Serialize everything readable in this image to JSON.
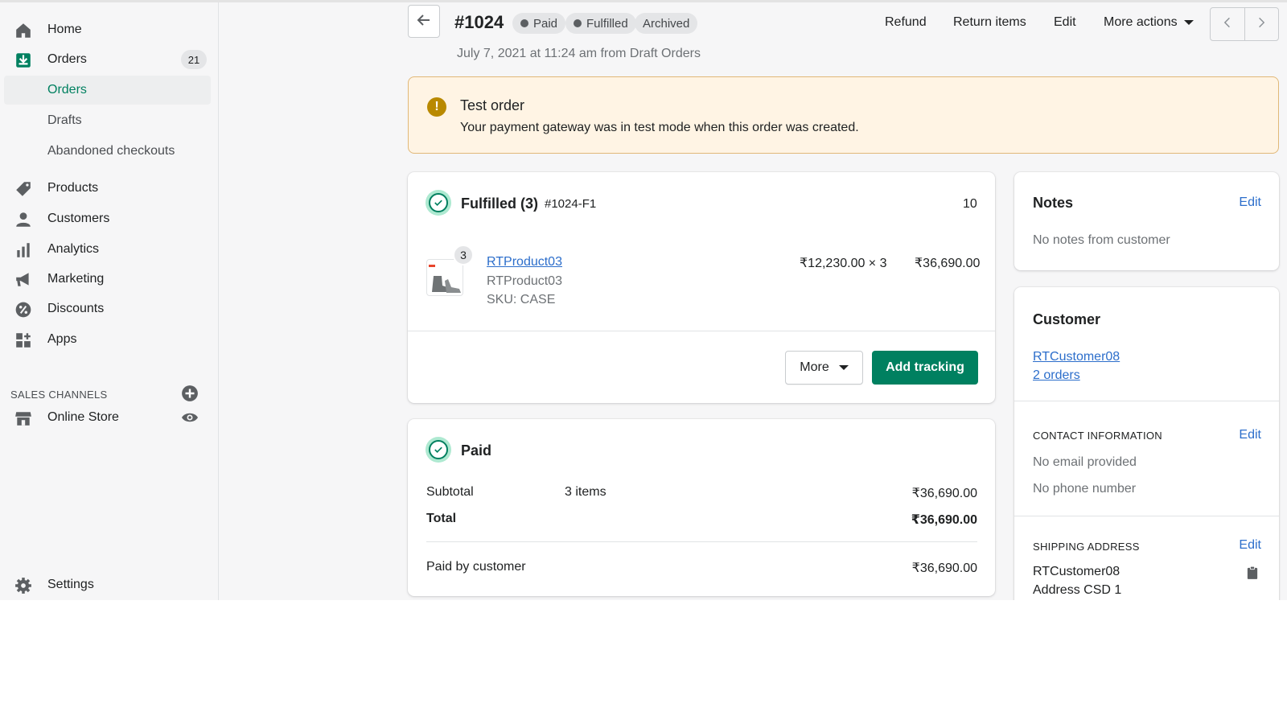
{
  "sidebar": {
    "home": "Home",
    "orders": "Orders",
    "orders_count": "21",
    "sub_orders": "Orders",
    "drafts": "Drafts",
    "abandoned": "Abandoned checkouts",
    "products": "Products",
    "customers": "Customers",
    "analytics": "Analytics",
    "marketing": "Marketing",
    "discounts": "Discounts",
    "apps": "Apps",
    "sales_channels_title": "SALES CHANNELS",
    "online_store": "Online Store",
    "settings": "Settings",
    "accent": "#008060"
  },
  "header": {
    "order_number": "#1024",
    "badges": [
      "Paid",
      "Fulfilled",
      "Archived"
    ],
    "subtitle": "July 7, 2021 at 11:24 am from Draft Orders",
    "actions": {
      "refund": "Refund",
      "return_items": "Return items",
      "edit": "Edit",
      "more_actions": "More actions"
    }
  },
  "banner": {
    "title": "Test order",
    "text": "Your payment gateway was in test mode when this order was created.",
    "icon": "warning-icon"
  },
  "fulfilled": {
    "title": "Fulfilled (3)",
    "fulfillment_id": "#1024-F1",
    "right_value": "10",
    "item": {
      "quantity_badge": "3",
      "name": "RTProduct03",
      "variant": "RTProduct03",
      "sku": "SKU: CASE",
      "unit_price_qty": "₹12,230.00 × 3",
      "line_total": "₹36,690.00"
    },
    "more_button": "More",
    "add_tracking_button": "Add tracking"
  },
  "paid": {
    "title": "Paid",
    "subtotal_label": "Subtotal",
    "subtotal_items": "3 items",
    "subtotal_value": "₹36,690.00",
    "total_label": "Total",
    "total_value": "₹36,690.00",
    "paid_by_label": "Paid by customer",
    "paid_by_value": "₹36,690.00"
  },
  "notes": {
    "title": "Notes",
    "edit": "Edit",
    "text": "No notes from customer"
  },
  "customer": {
    "title": "Customer",
    "name": "RTCustomer08",
    "orders": "2 orders",
    "contact_title": "CONTACT INFORMATION",
    "contact_edit": "Edit",
    "email": "No email provided",
    "phone": "No phone number",
    "shipping_title": "SHIPPING ADDRESS",
    "shipping_edit": "Edit",
    "address_name": "RTCustomer08",
    "address_line1": "Address CSD 1"
  }
}
